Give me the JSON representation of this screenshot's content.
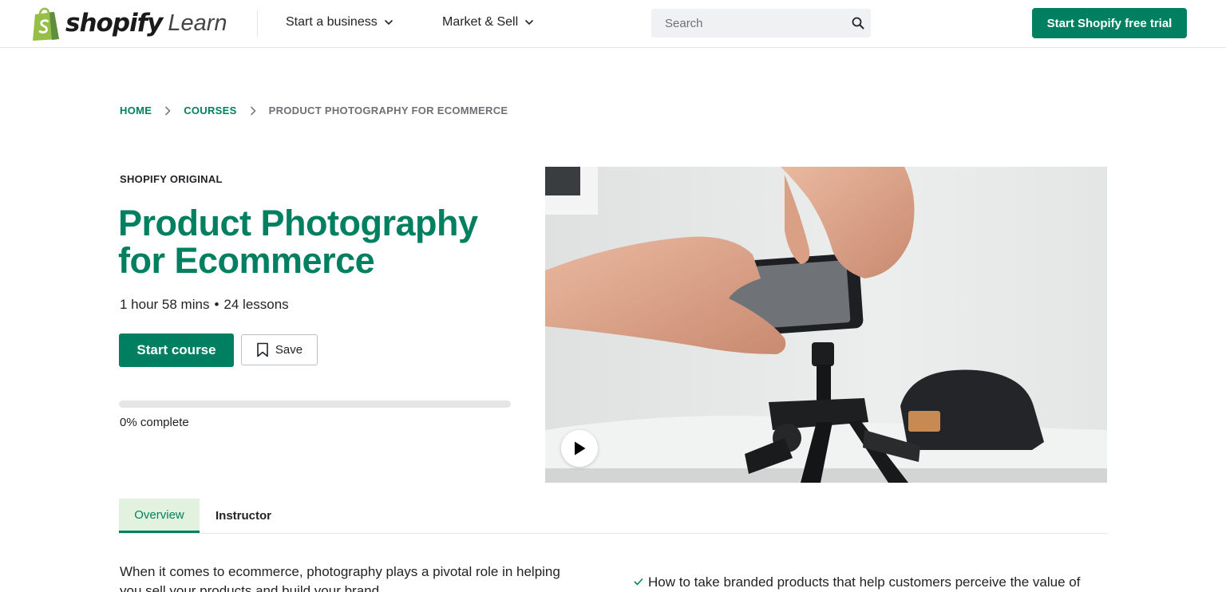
{
  "header": {
    "logo_word": "shopify",
    "logo_suffix": "Learn",
    "nav": [
      {
        "label": "Start a business"
      },
      {
        "label": "Market & Sell"
      }
    ],
    "search_placeholder": "Search",
    "trial_button": "Start Shopify free trial"
  },
  "breadcrumb": {
    "home": "HOME",
    "courses": "COURSES",
    "current": "PRODUCT PHOTOGRAPHY FOR ECOMMERCE"
  },
  "course": {
    "eyebrow": "SHOPIFY ORIGINAL",
    "title": "Product Photography for Ecommerce",
    "duration": "1 hour 58 mins",
    "separator": "•",
    "lessons": "24 lessons",
    "start_button": "Start course",
    "save_button": "Save",
    "progress_percent": 0,
    "progress_text": "0% complete"
  },
  "tabs": [
    {
      "label": "Overview",
      "active": true
    },
    {
      "label": "Instructor",
      "active": false
    }
  ],
  "overview": {
    "intro": "When it comes to ecommerce, photography plays a pivotal role in helping you sell your products and build your brand.",
    "learn_items": [
      "How to take branded products that help customers perceive the value of"
    ]
  },
  "icons": {
    "logo": "shopify-bag-icon",
    "chevron": "chevron-down-icon",
    "search": "search-icon",
    "breadcrumb_separator": "chevron-right-icon",
    "save": "bookmark-icon",
    "play": "play-icon",
    "check": "check-icon"
  },
  "colors": {
    "brand_green": "#008060",
    "logo_green": "#95bf47",
    "tab_active_bg": "#e3f1df",
    "text": "#212326",
    "muted": "#6d7175"
  }
}
